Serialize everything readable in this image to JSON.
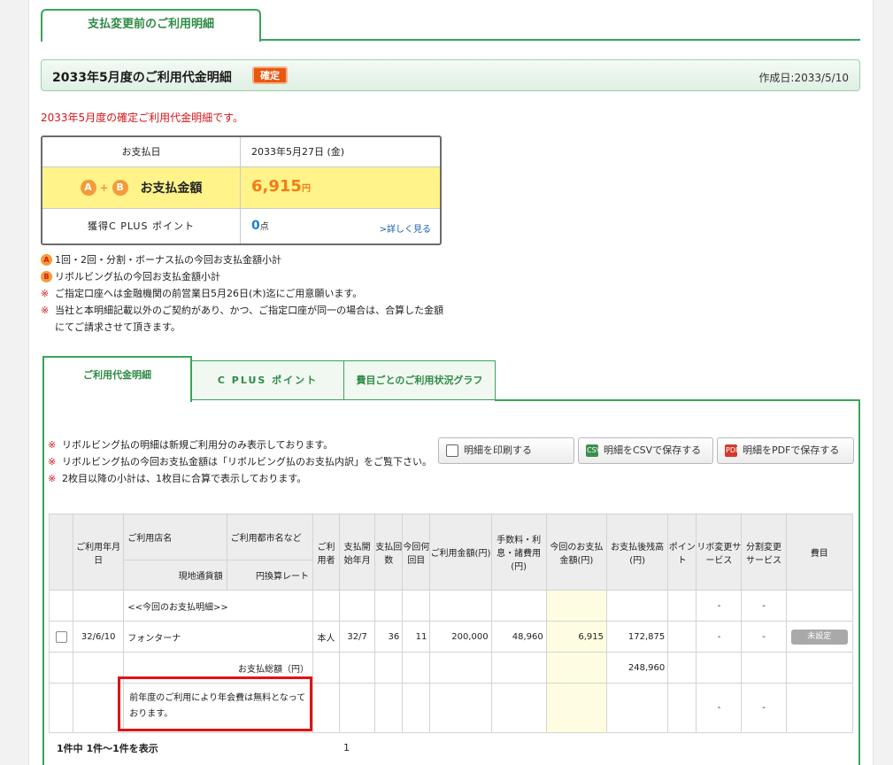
{
  "top_tab": "支払変更前のご利用明細",
  "header": {
    "title": "2033年5月度のご利用代金明細",
    "badge": "確定",
    "created": "作成日:2033/5/10"
  },
  "red_note": "2033年5月度の確定ご利用代金明細です。",
  "summary": {
    "pay_date_label": "お支払日",
    "pay_date_value": "2033年5月27日 (金)",
    "circle_a": "A",
    "circle_b": "B",
    "total_label": "お支払金額",
    "total_value": "6,915",
    "total_unit": "円",
    "points_label": "獲得C PLUS ポイント",
    "points_value": "0",
    "points_unit": "点",
    "points_link": ">詳しく見る"
  },
  "notes": [
    {
      "mark": "A",
      "text": "1回・2回・分割・ボーナス払の今回お支払金額小計"
    },
    {
      "mark": "B",
      "text": "リボルビング払の今回お支払金額小計"
    },
    {
      "mark": "※",
      "text": "ご指定口座へは金融機関の前営業日5月26日(木)迄にご用意願います。"
    },
    {
      "mark": "※",
      "text": "当社と本明細記載以外のご契約があり、かつ、ご指定口座が同一の場合は、合算した金額にてご請求させて頂きます。"
    }
  ],
  "tabs": [
    {
      "label": "ご利用代金明細"
    },
    {
      "label": "C PLUS ポイント"
    },
    {
      "label": "費目ごとのご利用状況グラフ"
    }
  ],
  "panel_notes": [
    "リボルビング払の明細は新規ご利用分のみ表示しております。",
    "リボルビング払の今回お支払金額は「リボルビング払のお支払内訳」をご覧下さい。",
    "2枚目以降の小計は、1枚目に合算で表示しております。"
  ],
  "buttons": {
    "print": "明細を印刷する",
    "csv": "明細をCSVで保存する",
    "pdf": "明細をPDFで保存する",
    "csv_icon": "CSV",
    "pdf_icon": "PDF"
  },
  "table": {
    "h_date": "ご利用年月日",
    "h_shop": "ご利用店名",
    "h_city": "ご利用都市名など",
    "h_currency": "現地通貨額",
    "h_rate": "円換算レート",
    "h_user": "ご利用者",
    "h_start": "支払開始年月",
    "h_count": "支払回数",
    "h_nth": "今回何回目",
    "h_amount": "ご利用金額(円)",
    "h_fee": "手数料・利息・諸費用(円)",
    "h_current": "今回のお支払金額(円)",
    "h_balance": "お支払後残高(円)",
    "h_point": "ポイント",
    "h_revo": "リボ変更サービス",
    "h_split": "分割変更サービス",
    "h_category": "費目",
    "section_label": "<<今回のお支払明細>>",
    "dash": "-",
    "row": {
      "date": "32/6/10",
      "shop": "フォンターナ",
      "user": "本人",
      "start": "32/7",
      "count": "36",
      "nth": "11",
      "amount": "200,000",
      "fee": "48,960",
      "current": "6,915",
      "balance": "172,875",
      "revo": "-",
      "split": "-",
      "category": "未設定"
    },
    "total_label": "お支払総額（円）",
    "total_balance": "248,960",
    "message": "前年度のご利用により年会費は無料となっております。"
  },
  "footer": {
    "count_text": "1件中 1件～1件を表示",
    "page": "1"
  }
}
